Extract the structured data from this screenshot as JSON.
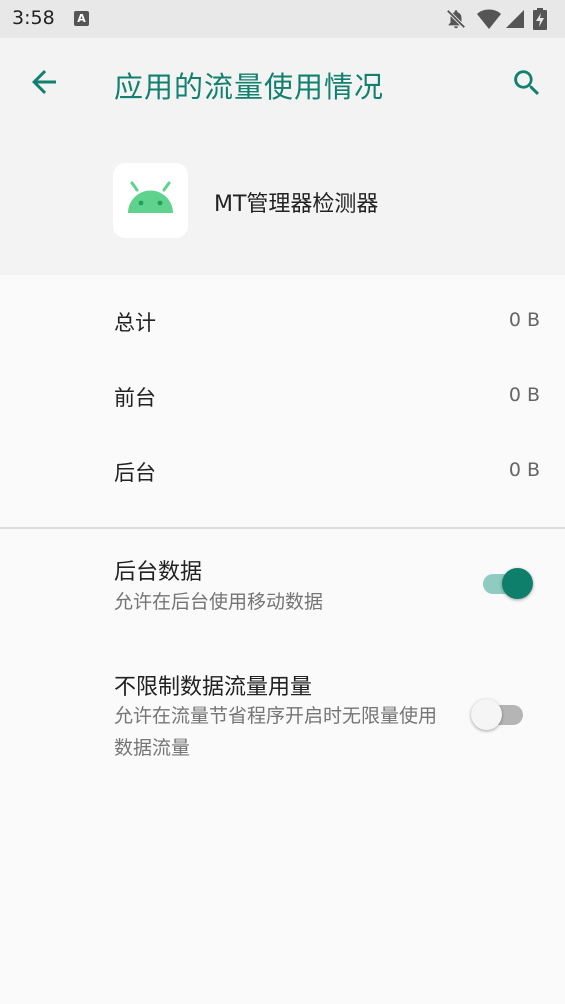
{
  "status_bar": {
    "time": "3:58",
    "notif_letter": "A"
  },
  "app_bar": {
    "title": "应用的流量使用情况"
  },
  "app": {
    "name": "MT管理器检测器"
  },
  "usage": [
    {
      "label": "总计",
      "value": "0 B"
    },
    {
      "label": "前台",
      "value": "0 B"
    },
    {
      "label": "后台",
      "value": "0 B"
    }
  ],
  "settings": [
    {
      "title": "后台数据",
      "subtitle": "允许在后台使用移动数据",
      "enabled": true
    },
    {
      "title": "不限制数据流量用量",
      "subtitle": "允许在流量节省程序开启时无限量使用数据流量",
      "enabled": false
    }
  ],
  "colors": {
    "accent": "#12806f",
    "toggle_on_thumb": "#0e7f6a",
    "toggle_on_track": "#8fcbc1",
    "toggle_off_thumb": "#f5f5f5",
    "toggle_off_track": "#b5b5b5",
    "android_green": "#5fd38d"
  }
}
